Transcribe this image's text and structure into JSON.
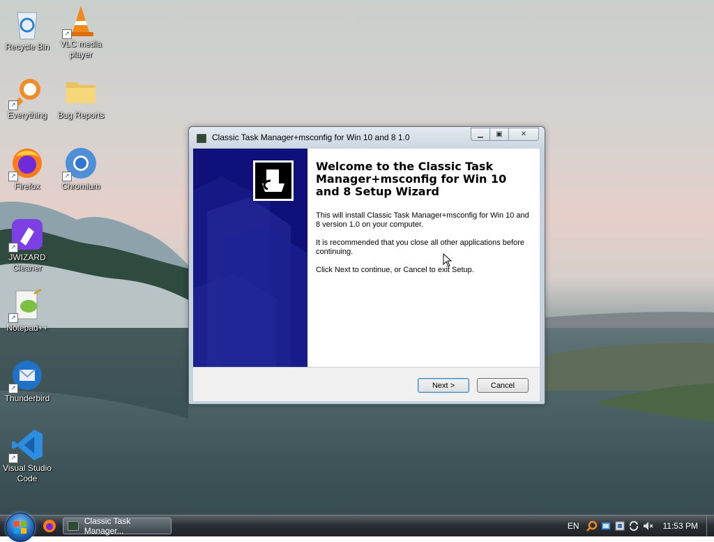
{
  "desktop": {
    "icons": [
      {
        "label": "Recycle Bin"
      },
      {
        "label": "VLC media player"
      },
      {
        "label": "Everything"
      },
      {
        "label": "Bug Reports"
      },
      {
        "label": "Firefox"
      },
      {
        "label": "Chromium"
      },
      {
        "label": "JWIZARD Cleaner"
      },
      {
        "label": "Notepad++"
      },
      {
        "label": "Thunderbird"
      },
      {
        "label": "Visual Studio Code"
      }
    ]
  },
  "window": {
    "title": "Classic Task Manager+msconfig for Win 10 and 8 1.0",
    "heading": "Welcome to the Classic Task Manager+msconfig for Win 10 and 8 Setup Wizard",
    "paragraphs": [
      "This will install Classic Task Manager+msconfig for Win 10 and 8 version 1.0 on your computer.",
      "It is recommended that you close all other applications before continuing.",
      "Click Next to continue, or Cancel to exit Setup."
    ],
    "next_label": "Next >",
    "cancel_label": "Cancel",
    "caption_buttons": {
      "minimize": "minimize-icon",
      "maximize": "maximize-icon",
      "close": "close-icon"
    }
  },
  "taskbar": {
    "task_button_label": "Classic Task Manager...",
    "language": "EN",
    "clock": "11:53 PM"
  },
  "colors": {
    "banner_blue": "#10107a",
    "taskbar_dark": "#1f2327"
  }
}
